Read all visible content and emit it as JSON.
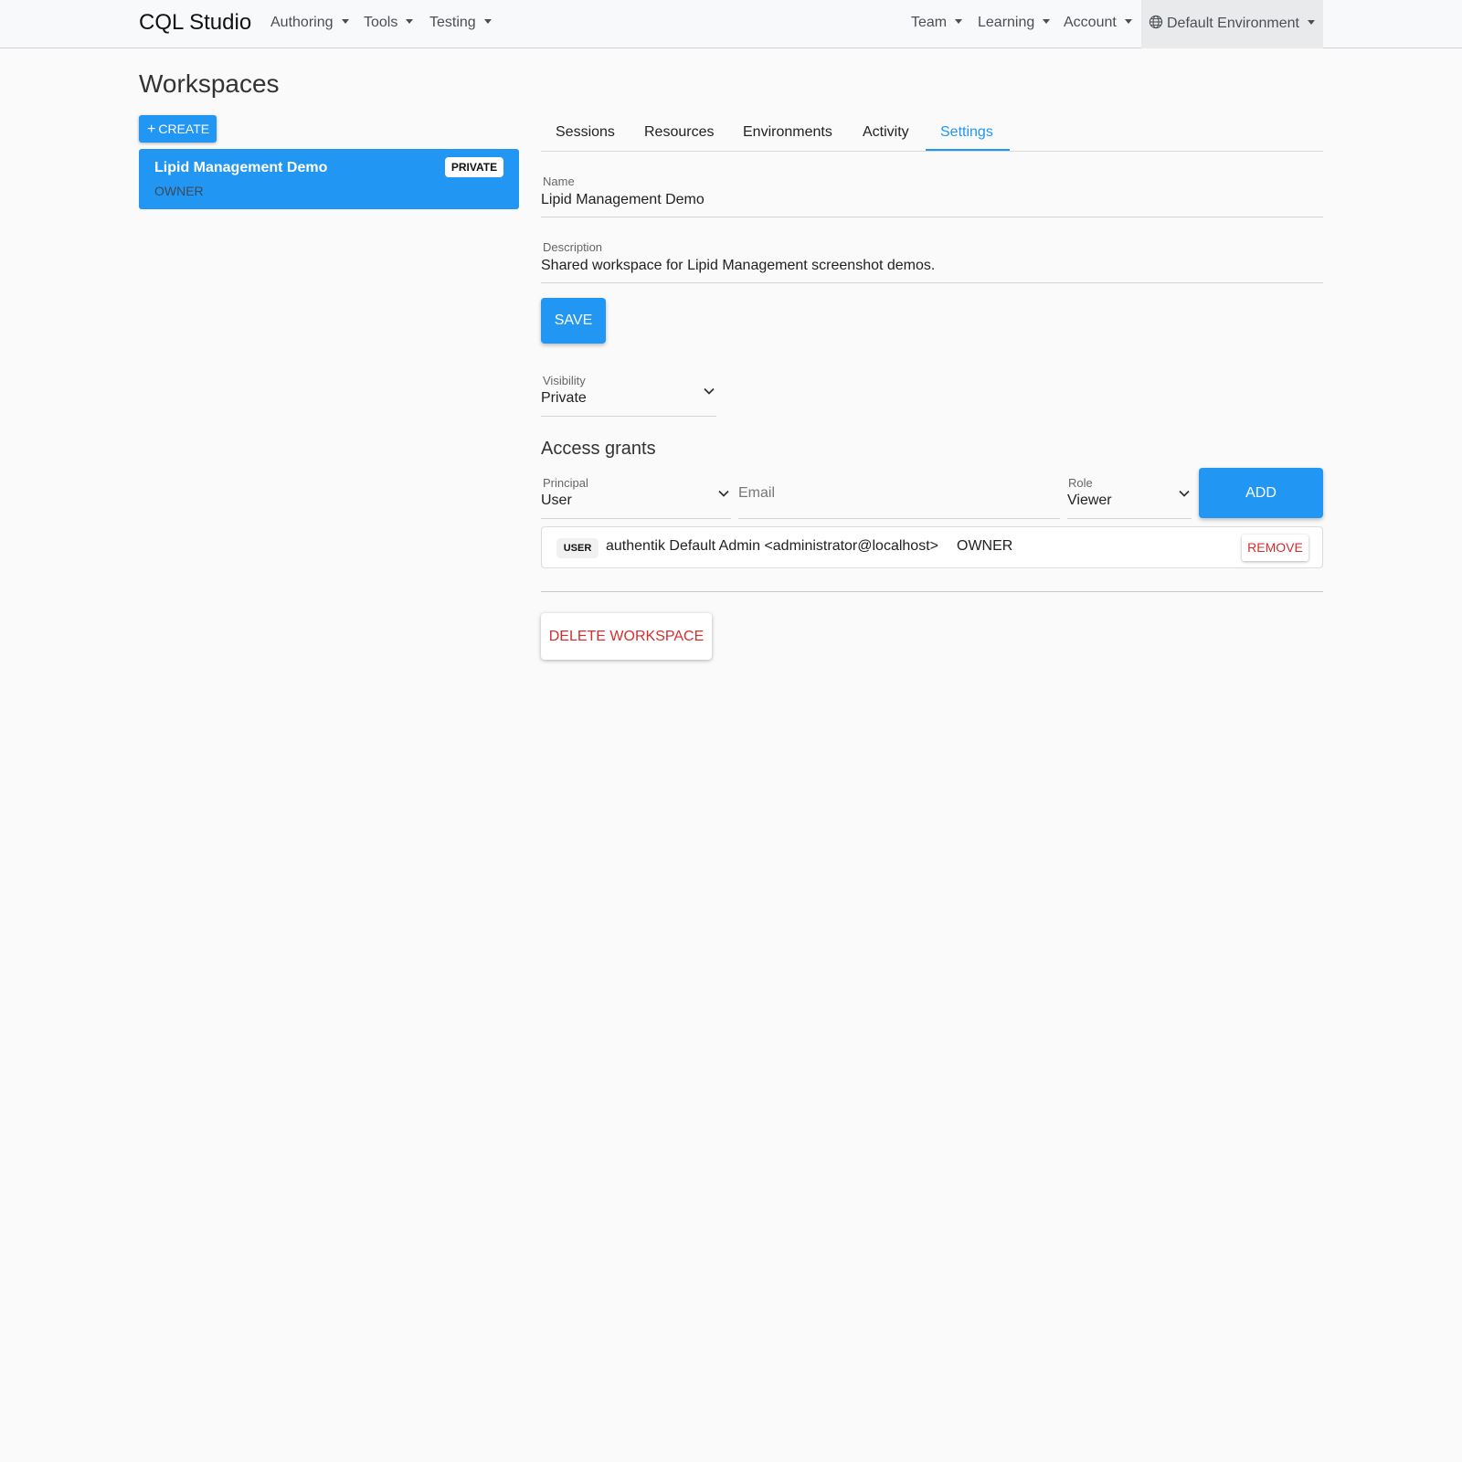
{
  "navbar": {
    "brand": "CQL Studio",
    "left_menus": [
      "Authoring",
      "Tools",
      "Testing"
    ],
    "right_menus": [
      "Team",
      "Learning",
      "Account"
    ],
    "environment": "Default Environment"
  },
  "page": {
    "title": "Workspaces"
  },
  "sidebar": {
    "create_label": "CREATE",
    "workspaces": [
      {
        "name": "Lipid Management Demo",
        "role": "OWNER",
        "visibility": "PRIVATE"
      }
    ]
  },
  "tabs": [
    {
      "label": "Sessions",
      "active": false
    },
    {
      "label": "Resources",
      "active": false
    },
    {
      "label": "Environments",
      "active": false
    },
    {
      "label": "Activity",
      "active": false
    },
    {
      "label": "Settings",
      "active": true
    }
  ],
  "settings": {
    "name_label": "Name",
    "name_value": "Lipid Management Demo",
    "description_label": "Description",
    "description_value": "Shared workspace for Lipid Management screenshot demos.",
    "save_label": "SAVE",
    "visibility_label": "Visibility",
    "visibility_value": "Private"
  },
  "access_grants": {
    "title": "Access grants",
    "principal_label": "Principal",
    "principal_value": "User",
    "email_placeholder": "Email",
    "role_label": "Role",
    "role_value": "Viewer",
    "add_label": "ADD",
    "grants": [
      {
        "type": "USER",
        "user": "authentik Default Admin <administrator@localhost>",
        "role": "OWNER",
        "remove_label": "REMOVE"
      }
    ]
  },
  "danger": {
    "delete_label": "DELETE WORKSPACE"
  },
  "colors": {
    "accent": "#2196f3",
    "danger": "#d32f2f",
    "navbar_bg": "#f8f9fa"
  }
}
